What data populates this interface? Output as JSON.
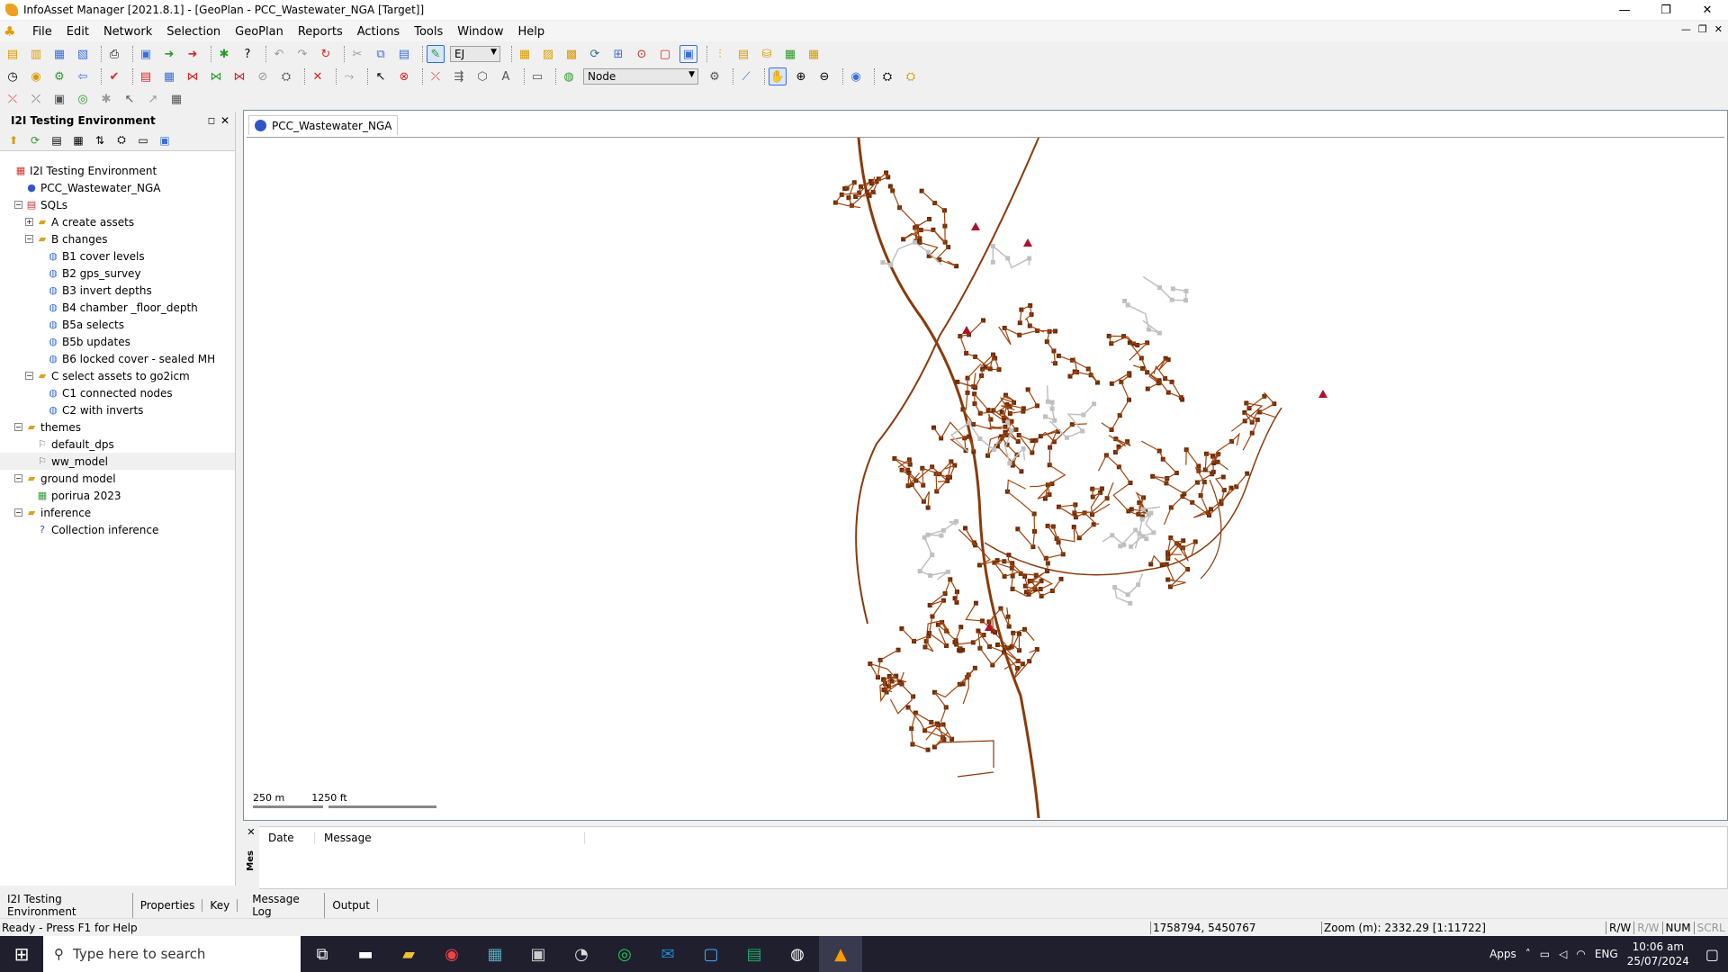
{
  "window": {
    "title": "InfoAsset Manager [2021.8.1] - [GeoPlan - PCC_Wastewater_NGA [Target]]",
    "controls": [
      "—",
      "❐",
      "✕"
    ]
  },
  "menu": [
    "File",
    "Edit",
    "Network",
    "Selection",
    "GeoPlan",
    "Reports",
    "Actions",
    "Tools",
    "Window",
    "Help"
  ],
  "toolbar": {
    "row1_combo": "EJ",
    "row2_combo": "Node"
  },
  "left_panel": {
    "title": "I2I Testing Environment",
    "tree": [
      {
        "label": "I2I Testing Environment",
        "level": 0,
        "expander": "",
        "icon": "db"
      },
      {
        "label": "PCC_Wastewater_NGA",
        "level": 1,
        "expander": "",
        "icon": "globe"
      },
      {
        "label": "SQLs",
        "level": 1,
        "expander": "−",
        "icon": "sqlfolder"
      },
      {
        "label": "A create assets",
        "level": 2,
        "expander": "+",
        "icon": "folder"
      },
      {
        "label": "B changes",
        "level": 2,
        "expander": "−",
        "icon": "folder"
      },
      {
        "label": "B1 cover levels",
        "level": 3,
        "expander": "",
        "icon": "sql"
      },
      {
        "label": "B2 gps_survey",
        "level": 3,
        "expander": "",
        "icon": "sql"
      },
      {
        "label": "B3 invert depths",
        "level": 3,
        "expander": "",
        "icon": "sql"
      },
      {
        "label": "B4 chamber _floor_depth",
        "level": 3,
        "expander": "",
        "icon": "sql"
      },
      {
        "label": "B5a selects",
        "level": 3,
        "expander": "",
        "icon": "sql"
      },
      {
        "label": "B5b updates",
        "level": 3,
        "expander": "",
        "icon": "sql"
      },
      {
        "label": "B6 locked cover - sealed MH",
        "level": 3,
        "expander": "",
        "icon": "sql"
      },
      {
        "label": "C select assets to go2icm",
        "level": 2,
        "expander": "−",
        "icon": "folder"
      },
      {
        "label": "C1 connected nodes",
        "level": 3,
        "expander": "",
        "icon": "sql"
      },
      {
        "label": "C2 with inverts",
        "level": 3,
        "expander": "",
        "icon": "sql"
      },
      {
        "label": "themes",
        "level": 1,
        "expander": "−",
        "icon": "themefolder"
      },
      {
        "label": "default_dps",
        "level": 2,
        "expander": "",
        "icon": "theme"
      },
      {
        "label": "ww_model",
        "level": 2,
        "expander": "",
        "icon": "theme",
        "selected": true
      },
      {
        "label": "ground model",
        "level": 1,
        "expander": "−",
        "icon": "gridfolder"
      },
      {
        "label": "porirua 2023",
        "level": 2,
        "expander": "",
        "icon": "grid"
      },
      {
        "label": "inference",
        "level": 1,
        "expander": "−",
        "icon": "inffolder"
      },
      {
        "label": "Collection inference",
        "level": 2,
        "expander": "",
        "icon": "inference"
      }
    ]
  },
  "map": {
    "tab_label": "PCC_Wastewater_NGA",
    "scale_m": "250 m",
    "scale_ft": "1250 ft",
    "network_color": "#a0440d",
    "faded_color": "#c0c0c0"
  },
  "messages": {
    "col_date": "Date",
    "col_message": "Message",
    "side_label": "Mes"
  },
  "bottom_tabs": [
    "I2I Testing Environment",
    "Properties",
    "Key",
    "Message Log",
    "Output"
  ],
  "status": {
    "left": "Ready - Press F1 for Help",
    "coords": "1758794, 5450767",
    "zoom": "Zoom (m): 2332.29 [1:11722]",
    "flags": [
      "R/W",
      "R/W",
      "NUM",
      "SCRL"
    ]
  },
  "taskbar": {
    "search_placeholder": "Type here to search",
    "apps_label": "Apps",
    "lang": "ENG",
    "time": "10:06 am",
    "date": "25/07/2024"
  }
}
